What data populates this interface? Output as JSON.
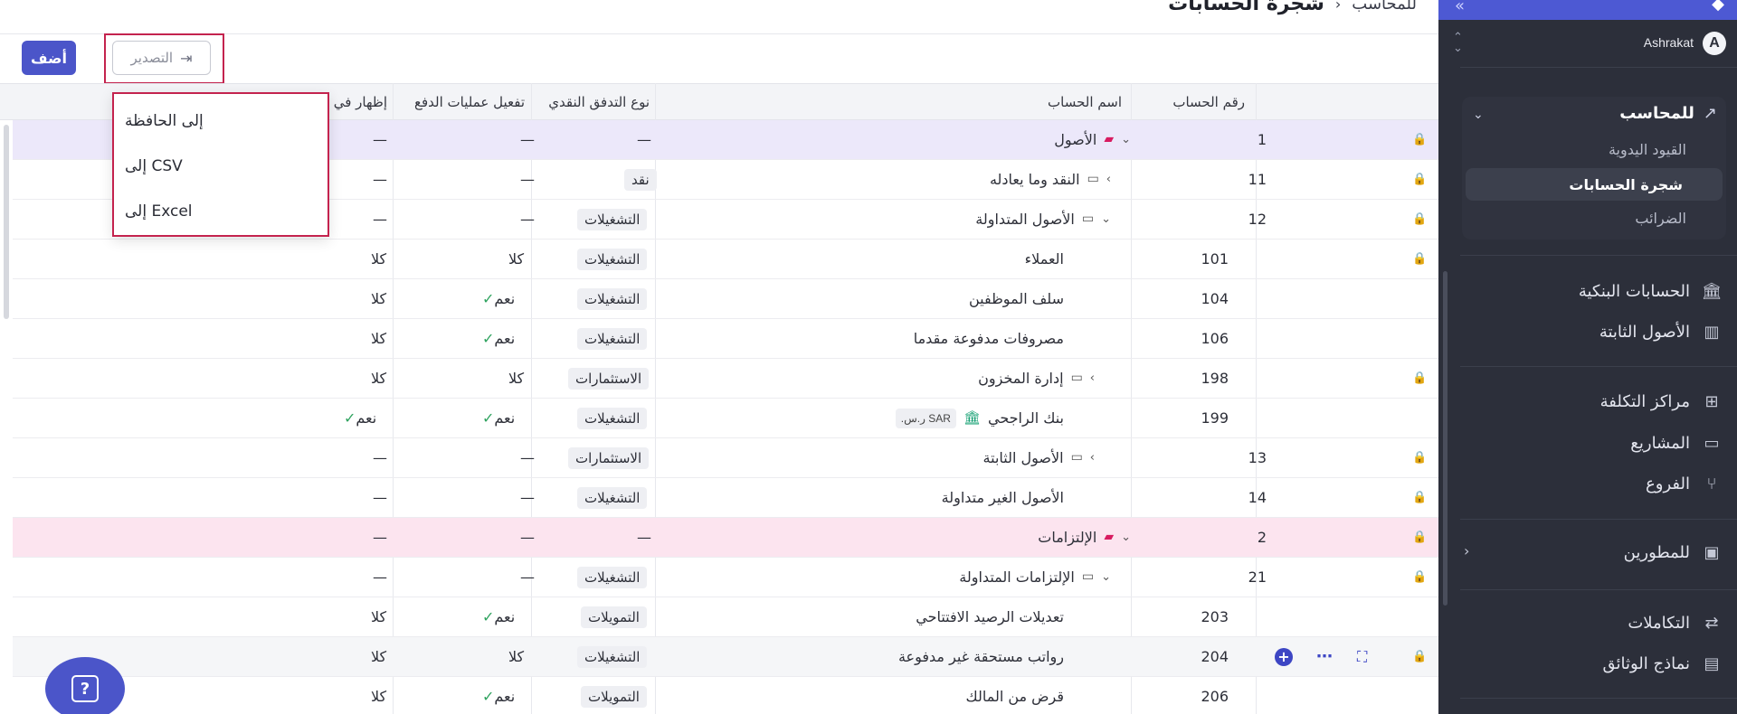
{
  "sidebar": {
    "org_name": "Ashrakat",
    "org_initial": "A",
    "accountant": {
      "label": "للمحاسب",
      "items": [
        {
          "label": "القيود اليدوية",
          "active": false
        },
        {
          "label": "شجرة الحسابات",
          "active": true
        },
        {
          "label": "الضرائب",
          "active": false
        }
      ]
    },
    "nav": [
      {
        "label": "الحسابات البنكية",
        "icon": "bank-icon"
      },
      {
        "label": "الأصول الثابتة",
        "icon": "building-icon"
      },
      {
        "label": "مراكز التكلفة",
        "icon": "grid-plus-icon"
      },
      {
        "label": "المشاريع",
        "icon": "folder-icon"
      },
      {
        "label": "الفروع",
        "icon": "branches-icon"
      },
      {
        "label": "للمطورين",
        "icon": "terminal-icon"
      },
      {
        "label": "التكاملات",
        "icon": "integrations-icon"
      },
      {
        "label": "نماذج الوثائق",
        "icon": "document-template-icon"
      }
    ]
  },
  "header": {
    "breadcrumb_parent": "للمحاسب",
    "title": "شجرة الحسابات"
  },
  "toolbar": {
    "add_label": "أضف",
    "export_label": "التصدير"
  },
  "export_menu": {
    "items": [
      "إلى الحافظة",
      "إلى CSV",
      "إلى Excel"
    ]
  },
  "table": {
    "columns": {
      "account_no": "رقم الحساب",
      "account_name": "اسم الحساب",
      "cashflow_type": "نوع التدفق النقدي",
      "payment_ops": "تفعيل عمليات الدفع",
      "show_in": "إظهار في"
    },
    "rows": [
      {
        "no": "1",
        "name": "الأصول",
        "cash": "—",
        "pay": "—",
        "show": "—"
      },
      {
        "no": "11",
        "name": "النقد وما يعادله",
        "cash": "نقد",
        "pay": "—",
        "show": "—"
      },
      {
        "no": "12",
        "name": "الأصول المتداولة",
        "cash": "التشغيلات",
        "pay": "—",
        "show": "—"
      },
      {
        "no": "101",
        "name": "العملاء",
        "cash": "التشغيلات",
        "pay": "كلا",
        "show": "كلا"
      },
      {
        "no": "104",
        "name": "سلف الموظفين",
        "cash": "التشغيلات",
        "pay": "نعم",
        "show": "كلا"
      },
      {
        "no": "106",
        "name": "مصروفات مدفوعة مقدما",
        "cash": "التشغيلات",
        "pay": "نعم",
        "show": "كلا"
      },
      {
        "no": "198",
        "name": "إدارة المخزون",
        "cash": "الاستثمارات",
        "pay": "كلا",
        "show": "كلا"
      },
      {
        "no": "199",
        "name": "بنك الراجحي",
        "cash": "التشغيلات",
        "pay": "نعم",
        "show": "نعم",
        "currency_code": "SAR",
        "currency_symbol": "ر.س."
      },
      {
        "no": "13",
        "name": "الأصول الثابتة",
        "cash": "الاستثمارات",
        "pay": "—",
        "show": "—"
      },
      {
        "no": "14",
        "name": "الأصول الغير متداولة",
        "cash": "التشغيلات",
        "pay": "—",
        "show": "—"
      },
      {
        "no": "2",
        "name": "الإلتزامات",
        "cash": "—",
        "pay": "—",
        "show": "—"
      },
      {
        "no": "21",
        "name": "الإلتزامات المتداولة",
        "cash": "التشغيلات",
        "pay": "—",
        "show": "—"
      },
      {
        "no": "203",
        "name": "تعديلات الرصيد الافتتاحي",
        "cash": "التمويلات",
        "pay": "نعم",
        "show": "كلا"
      },
      {
        "no": "204",
        "name": "رواتب مستحقة غير مدفوعة",
        "cash": "التشغيلات",
        "pay": "كلا",
        "show": "كلا"
      },
      {
        "no": "206",
        "name": "قرض من المالك",
        "cash": "التمويلات",
        "pay": "نعم",
        "show": "كلا"
      }
    ]
  },
  "colors": {
    "brand": "#4b55c9",
    "highlight": "#c4234e",
    "sidebar_bg": "#2c2f3a",
    "row_assets": "#ece8fa",
    "row_liabilities": "#fce4ef",
    "check": "#2fa35f"
  }
}
